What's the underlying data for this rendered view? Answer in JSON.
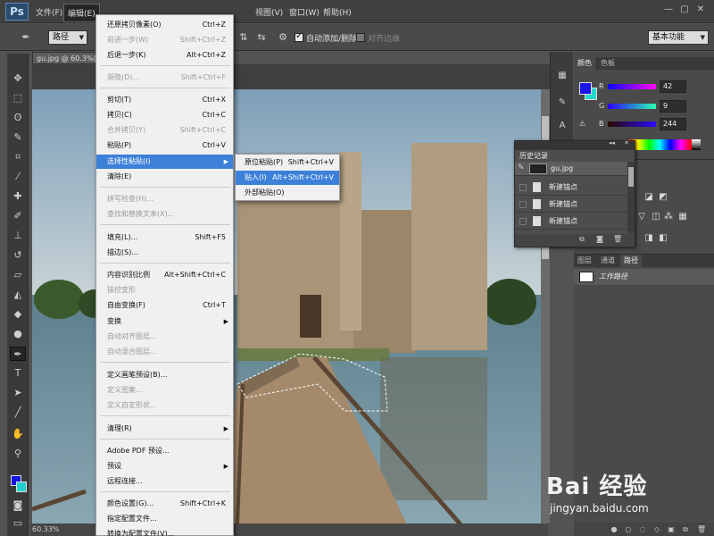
{
  "app": {
    "logo": "Ps",
    "window_controls": [
      "—",
      "▢",
      "✕"
    ]
  },
  "menubar": {
    "items": [
      "文件(F)",
      "编辑(E)",
      "视图(V)",
      "窗口(W)",
      "帮助(H)"
    ]
  },
  "options": {
    "tool_mode": "路径",
    "auto_add_delete_label": "自动添加/删除",
    "auto_add_delete_checked": true,
    "align_edges_label": "对齐边缘",
    "align_edges_checked": false,
    "workspace": "基本功能"
  },
  "document": {
    "tab_title": "gu.jpg @ 60.3%(R",
    "zoom": "60.33%"
  },
  "edit_menu": {
    "items": [
      {
        "label": "还原拷贝像素(O)",
        "shortcut": "Ctrl+Z",
        "disabled": false
      },
      {
        "label": "前进一步(W)",
        "shortcut": "Shift+Ctrl+Z",
        "disabled": true
      },
      {
        "label": "后退一步(K)",
        "shortcut": "Alt+Ctrl+Z",
        "disabled": false
      },
      {
        "label": "渐隐(D)...",
        "shortcut": "Shift+Ctrl+F",
        "disabled": true
      },
      {
        "label": "剪切(T)",
        "shortcut": "Ctrl+X",
        "disabled": false
      },
      {
        "label": "拷贝(C)",
        "shortcut": "Ctrl+C",
        "disabled": false
      },
      {
        "label": "合并拷贝(Y)",
        "shortcut": "Shift+Ctrl+C",
        "disabled": true
      },
      {
        "label": "粘贴(P)",
        "shortcut": "Ctrl+V",
        "disabled": false
      },
      {
        "label": "选择性粘贴(I)",
        "shortcut": "",
        "disabled": false,
        "submenu": true,
        "highlighted": true
      },
      {
        "label": "清除(E)",
        "shortcut": "",
        "disabled": false
      },
      {
        "label": "拼写检查(H)...",
        "shortcut": "",
        "disabled": true
      },
      {
        "label": "查找和替换文本(X)...",
        "shortcut": "",
        "disabled": true
      },
      {
        "label": "填充(L)...",
        "shortcut": "Shift+F5",
        "disabled": false
      },
      {
        "label": "描边(S)...",
        "shortcut": "",
        "disabled": false
      },
      {
        "label": "内容识别比例",
        "shortcut": "Alt+Shift+Ctrl+C",
        "disabled": false
      },
      {
        "label": "操控变形",
        "shortcut": "",
        "disabled": true
      },
      {
        "label": "自由变换(F)",
        "shortcut": "Ctrl+T",
        "disabled": false
      },
      {
        "label": "变换",
        "shortcut": "",
        "disabled": false,
        "submenu": true
      },
      {
        "label": "自动对齐图层...",
        "shortcut": "",
        "disabled": true
      },
      {
        "label": "自动混合图层...",
        "shortcut": "",
        "disabled": true
      },
      {
        "label": "定义画笔预设(B)...",
        "shortcut": "",
        "disabled": false
      },
      {
        "label": "定义图案...",
        "shortcut": "",
        "disabled": true
      },
      {
        "label": "定义自定形状...",
        "shortcut": "",
        "disabled": true
      },
      {
        "label": "清理(R)",
        "shortcut": "",
        "disabled": false,
        "submenu": true
      },
      {
        "label": "Adobe PDF 预设...",
        "shortcut": "",
        "disabled": false
      },
      {
        "label": "预设",
        "shortcut": "",
        "disabled": false,
        "submenu": true
      },
      {
        "label": "远程连接...",
        "shortcut": "",
        "disabled": false
      },
      {
        "label": "颜色设置(G)...",
        "shortcut": "Shift+Ctrl+K",
        "disabled": false
      },
      {
        "label": "指定配置文件...",
        "shortcut": "",
        "disabled": false
      },
      {
        "label": "转换为配置文件(V)...",
        "shortcut": "",
        "disabled": false
      }
    ]
  },
  "paste_submenu": {
    "items": [
      {
        "label": "原位粘贴(P)",
        "shortcut": "Shift+Ctrl+V",
        "highlighted": false
      },
      {
        "label": "贴入(I)",
        "shortcut": "Alt+Shift+Ctrl+V",
        "highlighted": true
      },
      {
        "label": "外部粘贴(O)",
        "shortcut": "",
        "highlighted": false
      }
    ]
  },
  "color_panel": {
    "tabs": [
      "颜色",
      "色板"
    ],
    "r_label": "R",
    "r_value": "42",
    "g_label": "G",
    "g_value": "9",
    "b_label": "B",
    "b_value": "244",
    "fg_color": "#2a09f4",
    "bg_color": "#24d8d0"
  },
  "history_panel": {
    "title": "历史记录",
    "snapshot_name": "gu.jpg",
    "entries": [
      "新建锚点",
      "新建锚点",
      "新建锚点"
    ]
  },
  "paths_panel": {
    "tabs": [
      "图层",
      "通道",
      "路径"
    ],
    "path_name": "工作路径"
  },
  "watermark": {
    "brand": "Bai 经验",
    "url": "jingyan.baidu.com"
  }
}
